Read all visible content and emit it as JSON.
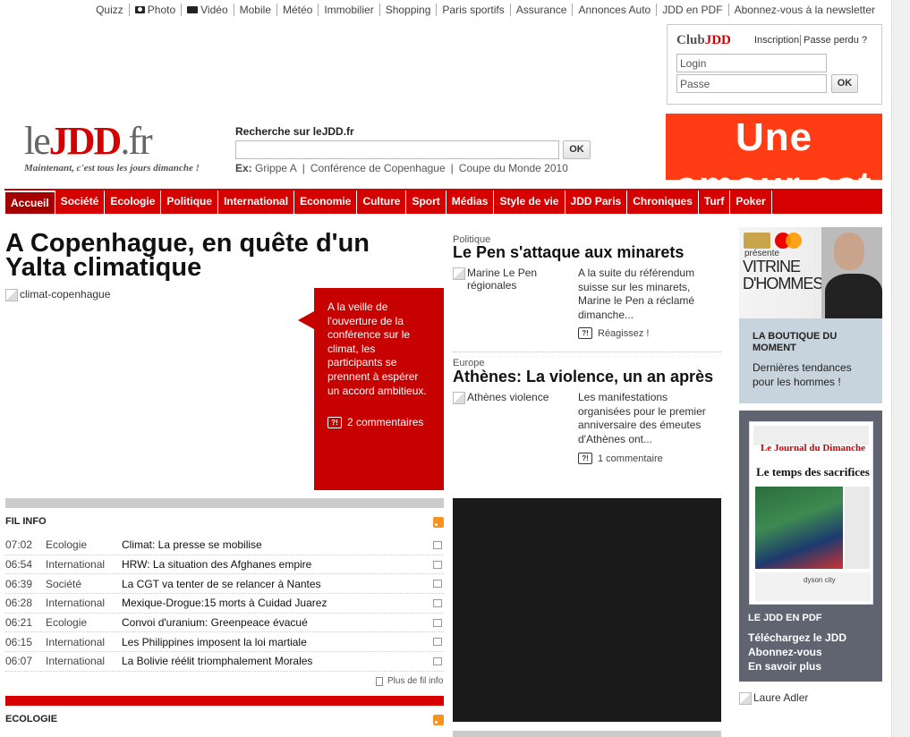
{
  "toplinks": [
    "Quizz",
    "Photo",
    "Vidéo",
    "Mobile",
    "Météo",
    "Immobilier",
    "Shopping",
    "Paris sportifs",
    "Assurance",
    "Annonces Auto",
    "JDD en PDF",
    "Abonnez-vous à la newsletter"
  ],
  "club": {
    "logo_prefix": "Club",
    "logo_brand": "JDD",
    "inscription": "Inscription",
    "passe_perdu": "Passe perdu ?",
    "login_placeholder": "Login",
    "passe_placeholder": "Passe",
    "ok": "OK"
  },
  "ad_top": {
    "line1": "Une",
    "line2": "amour est"
  },
  "logo": {
    "le": "le",
    "brand": "JDD",
    "fr": ".fr",
    "slogan": "Maintenant, c'est tous les jours dimanche !"
  },
  "search": {
    "title": "Recherche sur leJDD.fr",
    "ok": "OK",
    "ex_label": "Ex:",
    "examples": [
      "Grippe A",
      "Conférence de Copenhague",
      "Coupe du Monde 2010"
    ]
  },
  "nav": [
    "Accueil",
    "Société",
    "Ecologie",
    "Politique",
    "International",
    "Economie",
    "Culture",
    "Sport",
    "Médias",
    "Style de vie",
    "JDD Paris",
    "Chroniques",
    "Turf",
    "Poker"
  ],
  "main_story": {
    "headline": "A Copenhague, en quête d'un Yalta climatique",
    "img_alt": "climat-copenhague",
    "summary": "A la veille de l'ouverture de la conférence sur le climat, les participants se prennent à espérer un accord ambitieux.",
    "comments": "2 commentaires"
  },
  "fil_info": {
    "title": "FIL INFO",
    "rows": [
      {
        "time": "07:02",
        "cat": "Ecologie",
        "headline": "Climat: La presse se mobilise"
      },
      {
        "time": "06:54",
        "cat": "International",
        "headline": "HRW: La situation des Afghanes empire"
      },
      {
        "time": "06:39",
        "cat": "Société",
        "headline": "La CGT va tenter de se relancer à Nantes"
      },
      {
        "time": "06:28",
        "cat": "International",
        "headline": "Mexique-Drogue:15 morts à Cuidad Juarez"
      },
      {
        "time": "06:21",
        "cat": "Ecologie",
        "headline": "Convoi d'uranium: Greenpeace évacué"
      },
      {
        "time": "06:15",
        "cat": "International",
        "headline": "Les Philippines imposent la loi martiale"
      },
      {
        "time": "06:07",
        "cat": "International",
        "headline": "La Bolivie réélit triomphalement Morales"
      }
    ],
    "more": "Plus de fil info"
  },
  "ecologie": {
    "title": "ECOLOGIE"
  },
  "story2": {
    "kicker": "Politique",
    "title": "Le Pen s'attaque aux minarets",
    "img_alt": "Marine Le Pen régionales",
    "text": "A la suite du référendum suisse sur les minarets, Marine le Pen a réclamé dimanche...",
    "comment": "Réagissez !"
  },
  "story3": {
    "kicker": "Europe",
    "title": "Athènes: La violence, un an après",
    "img_alt": "Athènes violence",
    "text": "Les manifestations organisées pour le premier anniversaire des émeutes d'Athènes ont...",
    "comment": "1 commentaire"
  },
  "ad_vitrine": {
    "presente": "présente",
    "title": "VITRINE D'HOMMES"
  },
  "boutique": {
    "title": "LA BOUTIQUE DU MOMENT",
    "desc": "Dernières tendances pour les hommes !"
  },
  "pdf": {
    "cover_name": "Le Journal du Dimanche",
    "cover_headline": "Le temps des sacrifices",
    "cover_ad": "dyson city",
    "title": "LE JDD EN PDF",
    "links": [
      "Téléchargez le JDD",
      "Abonnez-vous",
      "En savoir plus"
    ]
  },
  "laure_adler": "Laure Adler",
  "colors": {
    "brand_red": "#d50000",
    "dark_red": "#c70000",
    "ad_orange": "#ff3c14"
  }
}
